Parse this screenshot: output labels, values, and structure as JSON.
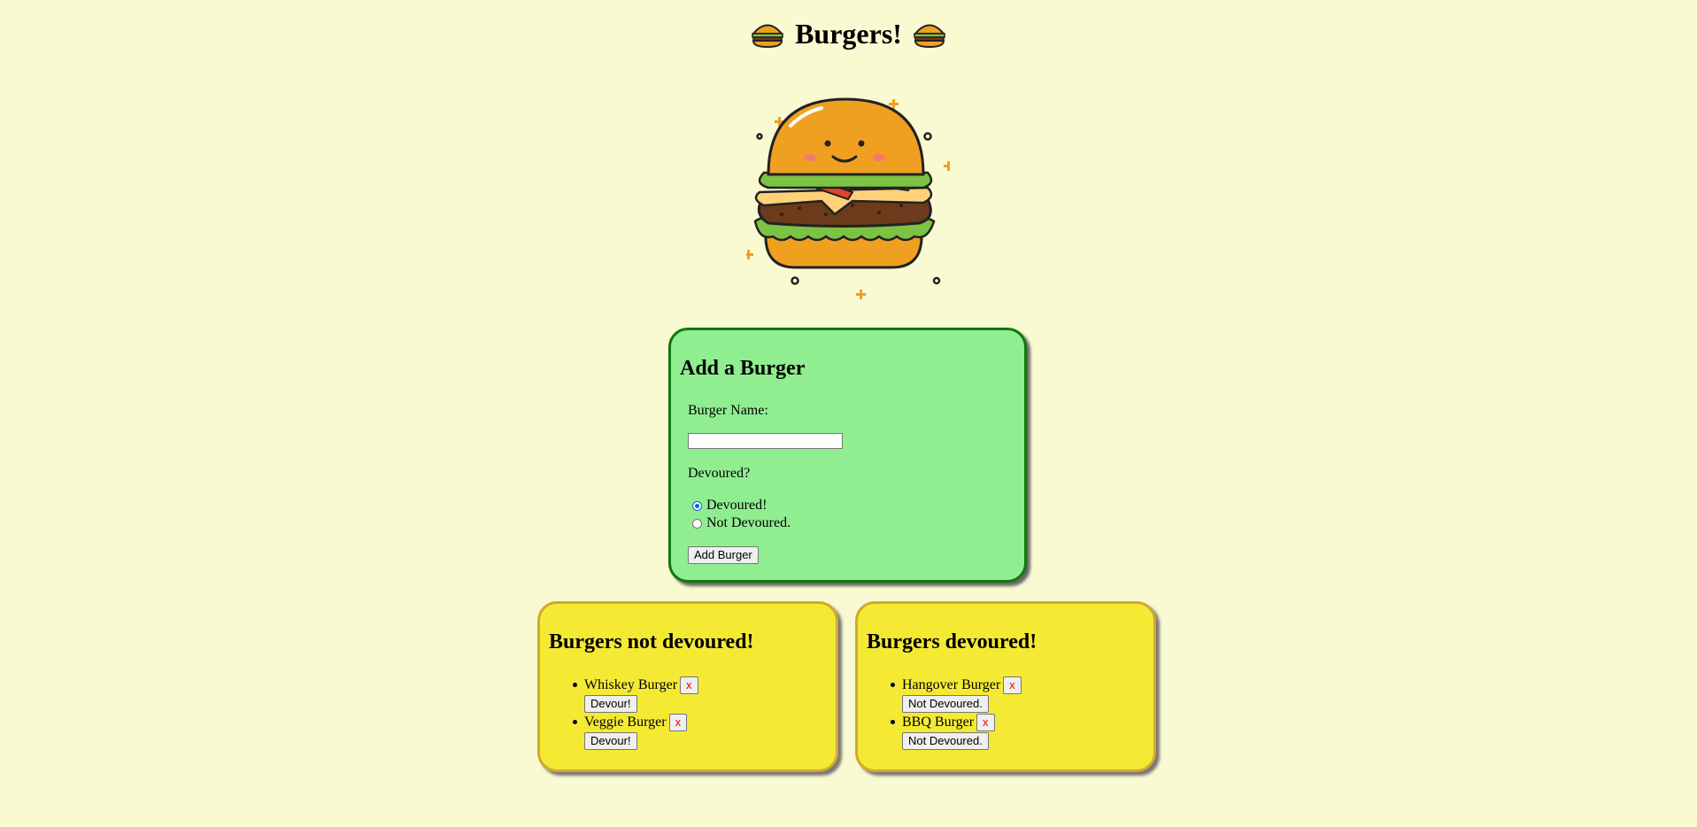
{
  "header": {
    "title": "Burgers!",
    "left_icon": "burger-icon",
    "right_icon": "burger-icon"
  },
  "hero": {
    "icon": "smiling-burger-illustration"
  },
  "add_form": {
    "heading": "Add a Burger",
    "name_label": "Burger Name:",
    "name_value": "",
    "devoured_label": "Devoured?",
    "radio_devoured": "Devoured!",
    "radio_not_devoured": "Not Devoured.",
    "selected": "Devoured!",
    "submit_label": "Add Burger"
  },
  "not_devoured": {
    "heading": "Burgers not devoured!",
    "items": [
      {
        "name": "Whiskey Burger",
        "delete_label": "x",
        "action_label": "Devour!"
      },
      {
        "name": "Veggie Burger",
        "delete_label": "x",
        "action_label": "Devour!"
      }
    ]
  },
  "devoured": {
    "heading": "Burgers devoured!",
    "items": [
      {
        "name": "Hangover Burger",
        "delete_label": "x",
        "action_label": "Not Devoured."
      },
      {
        "name": "BBQ Burger",
        "delete_label": "x",
        "action_label": "Not Devoured."
      }
    ]
  },
  "colors": {
    "background": "#fafad2",
    "add_card": "#90ee90",
    "add_card_border": "#117711",
    "list_card": "#f4ea34",
    "list_card_border": "#d2a830",
    "delete_text": "#ee0000"
  }
}
